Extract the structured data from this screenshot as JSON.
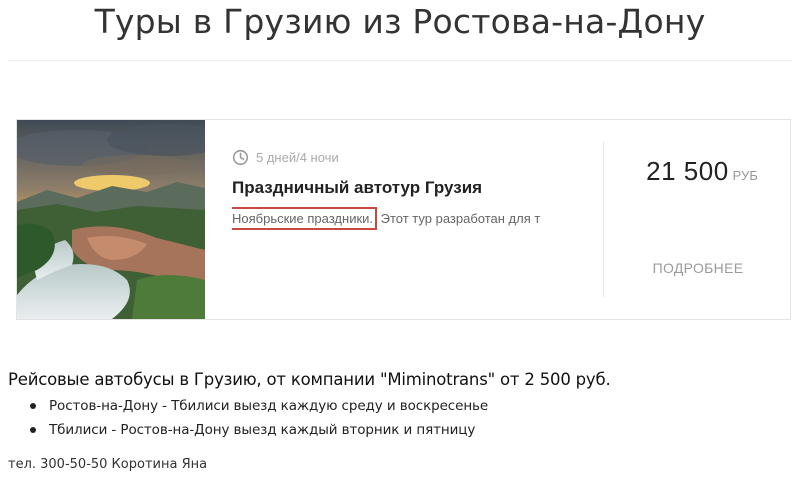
{
  "page": {
    "title": "Туры в Грузию из Ростова-на-Дону"
  },
  "tour": {
    "photo_icon": "landscape-photo",
    "duration": "5 дней/4 ночи",
    "duration_icon": "clock-icon",
    "name": "Праздничный автотур Грузия",
    "desc_highlight": "Ноябрьские праздники.",
    "desc_rest": " Этот тур разработан для т",
    "price": "21 500",
    "currency": "РУБ",
    "details_label": "ПОДРОБНЕЕ"
  },
  "bus_section": {
    "heading": "Рейсовые автобусы в Грузию, от компании \"Miminotrans\" от 2 500 руб.",
    "routes": [
      "Ростов-на-Дону - Тбилиси выезд каждую среду и воскресенье",
      "Тбилиси - Ростов-на-Дону  выезд каждый вторник и пятницу"
    ],
    "contact": "тел. 300-50-50 Коротина Яна"
  },
  "colors": {
    "highlight_border": "#c8493f",
    "text_muted": "#aaaaaa",
    "divider": "#e6e6e6"
  }
}
